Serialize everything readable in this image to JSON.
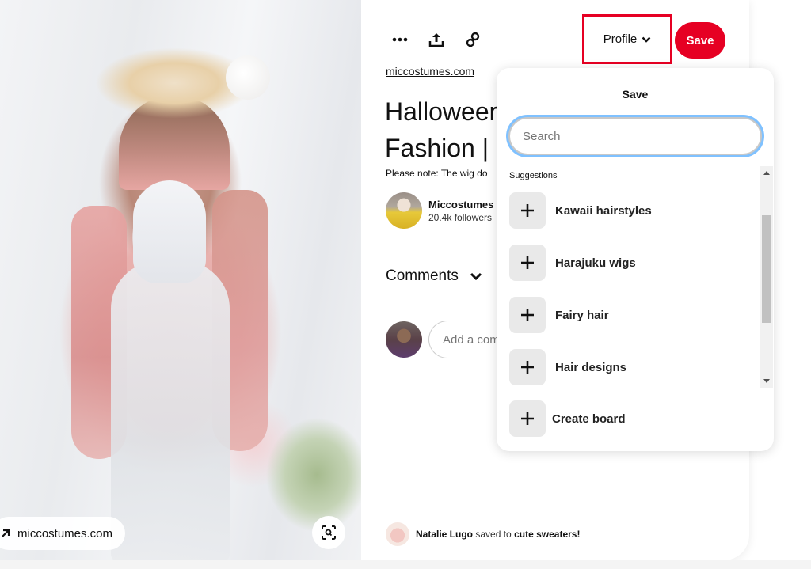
{
  "image": {
    "source_chip_label": "miccostumes.com",
    "source_chip_icon": "arrow-up-right-icon",
    "lens_icon": "visual-search-icon"
  },
  "toolbar": {
    "more_icon": "ellipsis-icon",
    "share_icon": "share-upload-icon",
    "link_icon": "link-icon",
    "profile_label": "Profile",
    "save_label": "Save"
  },
  "pin": {
    "domain": "miccostumes.com",
    "title": "Halloween Fashion |",
    "title_line1": "Halloweer",
    "title_line2": "Fashion |",
    "description": "Please note: The wig do",
    "creator": {
      "name": "Miccostumes",
      "followers": "20.4k followers"
    }
  },
  "comments": {
    "heading": "Comments",
    "input_placeholder": "Add a comment"
  },
  "activity": {
    "user": "Natalie Lugo",
    "action": "saved to",
    "board": "cute sweaters!"
  },
  "save_popover": {
    "title": "Save",
    "search_placeholder": "Search",
    "suggestions_label": "Suggestions",
    "boards": [
      {
        "label": "Kawaii hairstyles"
      },
      {
        "label": "Harajuku wigs"
      },
      {
        "label": "Fairy hair"
      },
      {
        "label": "Hair designs"
      }
    ],
    "create_board_label": "Create board"
  },
  "colors": {
    "brand_red": "#e60023",
    "focus_ring": "#7fc1ff",
    "highlight_box": "#e60023"
  }
}
